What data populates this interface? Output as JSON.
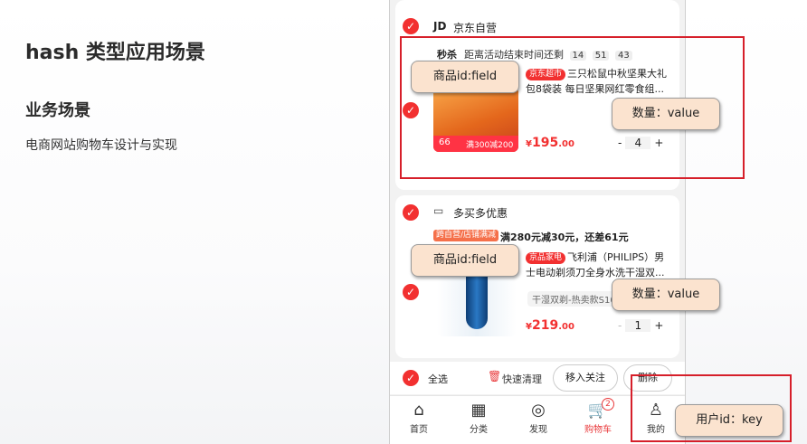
{
  "slide": {
    "title": "hash 类型应用场景",
    "subtitle": "业务场景",
    "body": "电商网站购物车设计与实现"
  },
  "cart": {
    "store1": {
      "logo": "JD",
      "name": "京东自营",
      "seckill_label": "秒杀",
      "seckill_text": "距离活动结束时间还剩",
      "timer": [
        "14",
        "51",
        "43"
      ],
      "product": {
        "badge": "京东超市",
        "title": "三只松鼠中秋坚果大礼包8袋装 每日坚果网红零食组...",
        "img_tag_left": "66",
        "img_tag_right": "满300减200",
        "price_symbol": "¥",
        "price_int": "195",
        "price_dec": ".00",
        "qty": "4",
        "minus": "-",
        "plus": "+"
      }
    },
    "store2": {
      "name": "多买多优惠",
      "promo_tag": "跨自营/店铺满减",
      "promo_text": "满280元减30元，还差61元",
      "product": {
        "badge": "京品家电",
        "title": "飞利浦（PHILIPS）男士电动剃须刀全身水洗干湿双...",
        "spec": "干湿双剃-热卖款S10",
        "price_symbol": "¥",
        "price_int": "219",
        "price_dec": ".00",
        "qty": "1",
        "minus": "-",
        "plus": "+"
      }
    },
    "bottom": {
      "select_all": "全选",
      "clear": "快速清理",
      "move_to_follow": "移入关注",
      "delete": "删除"
    },
    "tabs": [
      {
        "label": "首页",
        "icon": "home-icon",
        "glyph": "⌂"
      },
      {
        "label": "分类",
        "icon": "category-icon",
        "glyph": "▦"
      },
      {
        "label": "发现",
        "icon": "discover-icon",
        "glyph": "◎"
      },
      {
        "label": "购物车",
        "icon": "cart-icon",
        "glyph": "🛒",
        "badge": "2"
      },
      {
        "label": "我的",
        "icon": "user-icon",
        "glyph": "♙"
      }
    ]
  },
  "annotations": {
    "product_id_1": "商品id:field",
    "quantity_1": "数量：value",
    "product_id_2": "商品id:field",
    "quantity_2": "数量：value",
    "user_id": "用户id：key"
  },
  "colors": {
    "accent": "#f23030",
    "annotation_box": "#d61f2a",
    "callout_bg": "#fbe3cf"
  }
}
